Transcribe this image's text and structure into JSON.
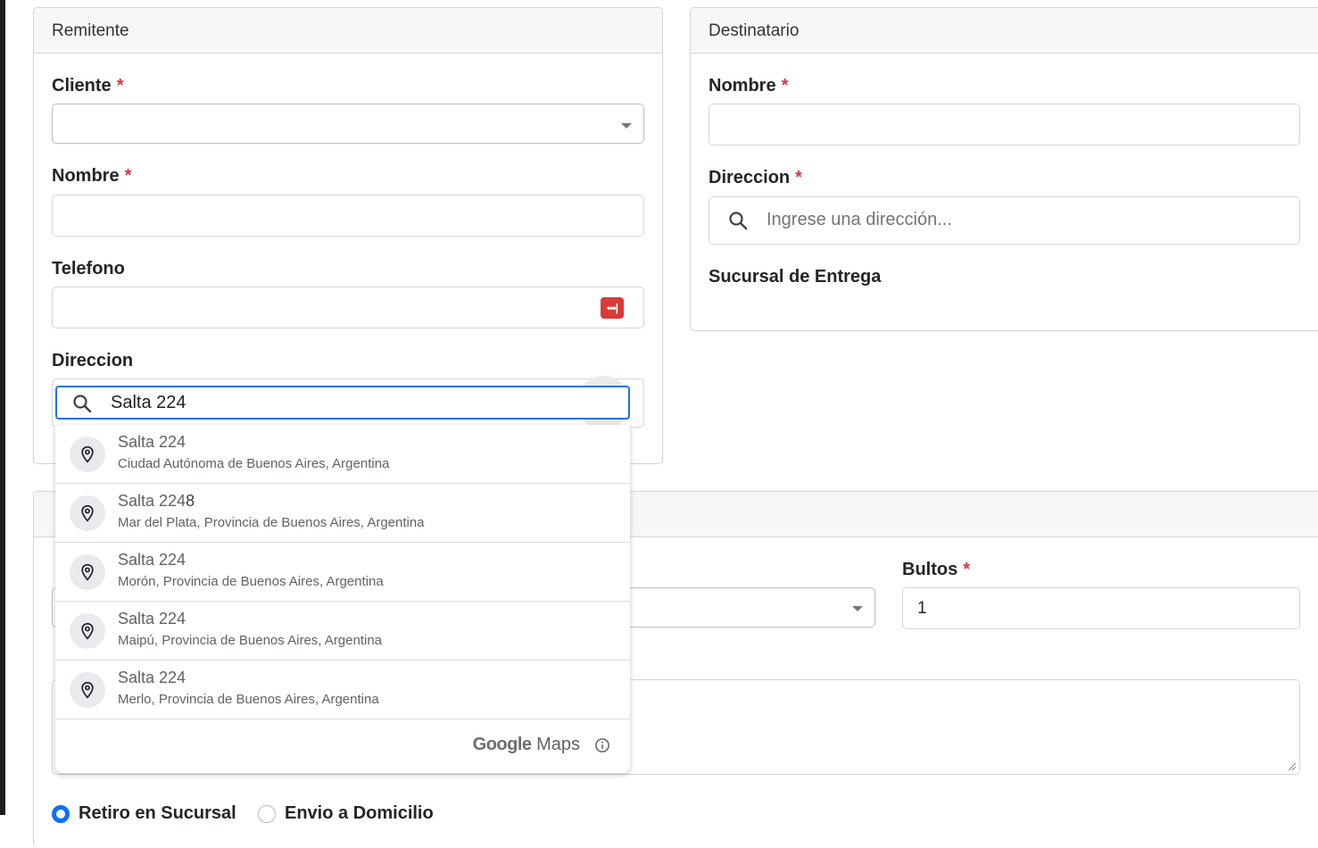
{
  "remitente": {
    "title": "Remitente",
    "cliente_label": "Cliente",
    "nombre_label": "Nombre",
    "telefono_label": "Telefono",
    "direccion_label": "Direccion",
    "direccion_value": "Salta 224",
    "required_mark": "*"
  },
  "destinatario": {
    "title": "Destinatario",
    "nombre_label": "Nombre",
    "direccion_label": "Direccion",
    "direccion_placeholder": "Ingrese una dirección...",
    "sucursal_label": "Sucursal de Entrega",
    "required_mark": "*"
  },
  "detalle": {
    "bultos_label": "Bultos",
    "bultos_value": "1",
    "required_mark": "*",
    "radio_retiro": "Retiro en Sucursal",
    "radio_envio": "Envio a Domicilio"
  },
  "autocomplete": {
    "suggestions": [
      {
        "main_match": "Salta 224",
        "main_rest": "",
        "sub": "Ciudad Autónoma de Buenos Aires, Argentina"
      },
      {
        "main_match": "Salta 224",
        "main_rest": "8",
        "sub": "Mar del Plata, Provincia de Buenos Aires, Argentina"
      },
      {
        "main_match": "Salta 224",
        "main_rest": "",
        "sub": "Morón, Provincia de Buenos Aires, Argentina"
      },
      {
        "main_match": "Salta 224",
        "main_rest": "",
        "sub": "Maipú, Provincia de Buenos Aires, Argentina"
      },
      {
        "main_match": "Salta 224",
        "main_rest": "",
        "sub": "Merlo, Provincia de Buenos Aires, Argentina"
      }
    ],
    "footer_brand_google": "Google",
    "footer_brand_maps": "Maps"
  },
  "icons": {
    "search": "search-icon",
    "clear": "clear-circle-icon",
    "pin": "location-pin-icon",
    "info": "info-icon",
    "password": "password-manager-icon",
    "caret": "chevron-down-icon"
  },
  "colors": {
    "required": "#dc3545",
    "focus_border": "#1a73e8",
    "radio_checked": "#0d6efd",
    "password_icon": "#d93a3a"
  }
}
